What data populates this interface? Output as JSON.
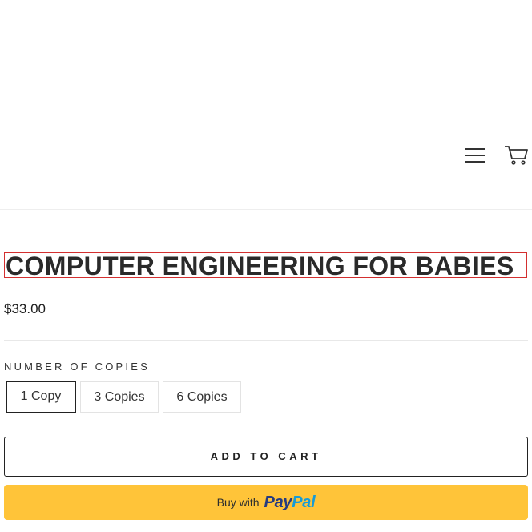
{
  "header": {
    "menu_icon": "hamburger-menu-icon",
    "cart_icon": "shopping-cart-icon"
  },
  "product": {
    "title": "COMPUTER ENGINEERING FOR BABIES",
    "price": "$33.00"
  },
  "variants": {
    "label": "NUMBER OF COPIES",
    "options": [
      "1 Copy",
      "3 Copies",
      "6 Copies"
    ],
    "selected": "1 Copy"
  },
  "actions": {
    "add_to_cart": "ADD TO CART",
    "paypal_prefix": "Buy with",
    "paypal_logo_pay": "Pay",
    "paypal_logo_pal": "Pal"
  },
  "colors": {
    "paypal_yellow": "#ffc439",
    "paypal_dark_blue": "#253b80",
    "paypal_light_blue": "#179bd7",
    "title_outline": "#d32f2f"
  }
}
